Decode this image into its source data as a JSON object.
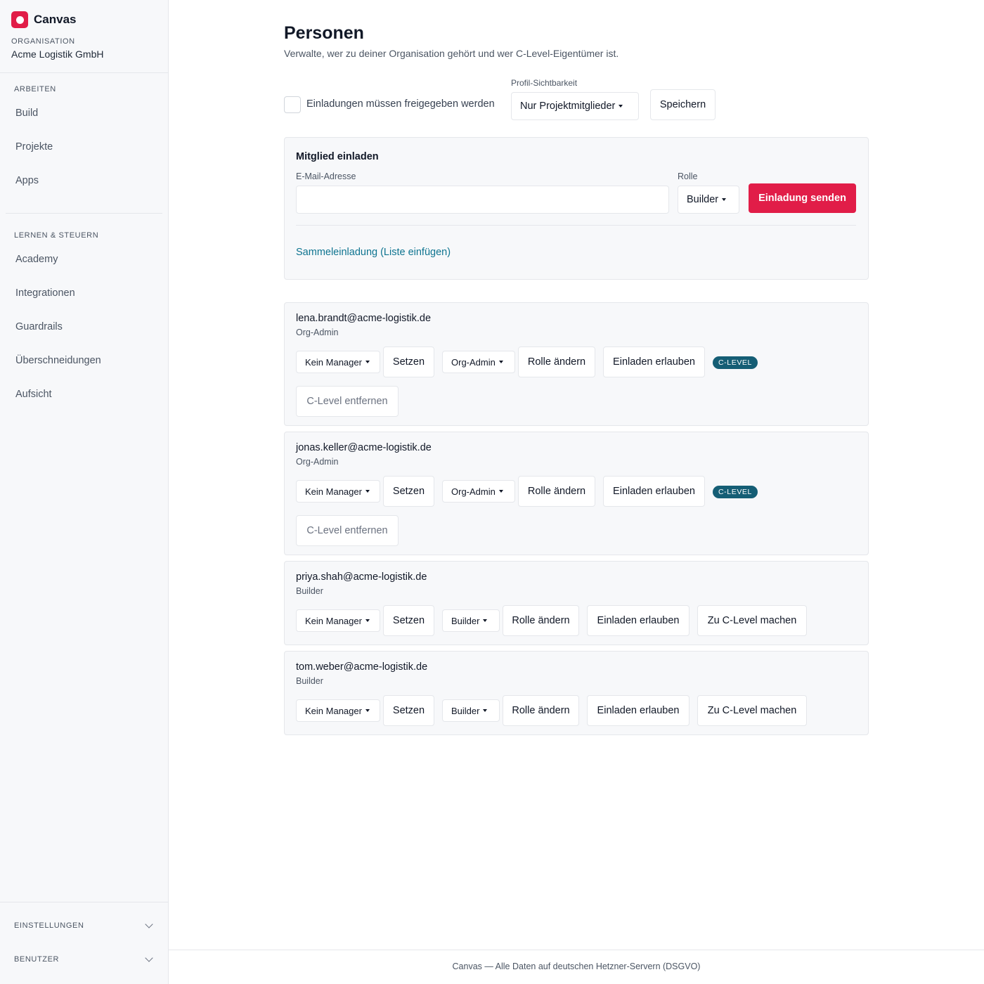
{
  "brand": {
    "name": "Canvas",
    "accent": "#e11d48"
  },
  "organization": {
    "label": "ORGANISATION",
    "name": "Acme Logistik GmbH"
  },
  "sidebar": {
    "sections": [
      {
        "label": "ARBEITEN",
        "items": [
          "Build",
          "Projekte",
          "Apps"
        ]
      },
      {
        "label": "LERNEN & STEUERN",
        "items": [
          "Academy",
          "Integrationen",
          "Guardrails",
          "Überschneidungen",
          "Aufsicht"
        ]
      }
    ],
    "collapsibles": [
      "EINSTELLUNGEN",
      "BENUTZER"
    ]
  },
  "page": {
    "title": "Personen",
    "subtitle": "Verwalte, wer zu deiner Organisation gehört und wer C-Level-Eigentümer ist."
  },
  "settings": {
    "approval_label": "Einladungen müssen freigegeben werden",
    "approval_checked": false,
    "visibility_label": "Profil-Sichtbarkeit",
    "visibility_value": "Nur Projektmitglieder",
    "save_label": "Speichern"
  },
  "invite": {
    "title": "Mitglied einladen",
    "email_label": "E-Mail-Adresse",
    "email_value": "",
    "role_label": "Rolle",
    "role_value": "Builder",
    "send_label": "Einladung senden",
    "bulk_link": "Sammeleinladung (Liste einfügen)"
  },
  "members": [
    {
      "email": "lena.brandt@acme-logistik.de",
      "role": "Org-Admin",
      "manager_value": "Kein Manager",
      "set_label": "Setzen",
      "role_select_value": "Org-Admin",
      "change_role_label": "Rolle ändern",
      "allow_invite_label": "Einladen erlauben",
      "badge": "C-LEVEL",
      "clevel_action": "C-Level entfernen"
    },
    {
      "email": "jonas.keller@acme-logistik.de",
      "role": "Org-Admin",
      "manager_value": "Kein Manager",
      "set_label": "Setzen",
      "role_select_value": "Org-Admin",
      "change_role_label": "Rolle ändern",
      "allow_invite_label": "Einladen erlauben",
      "badge": "C-LEVEL",
      "clevel_action": "C-Level entfernen"
    },
    {
      "email": "priya.shah@acme-logistik.de",
      "role": "Builder",
      "manager_value": "Kein Manager",
      "set_label": "Setzen",
      "role_select_value": "Builder",
      "change_role_label": "Rolle ändern",
      "allow_invite_label": "Einladen erlauben",
      "clevel_action": "Zu C-Level machen"
    },
    {
      "email": "tom.weber@acme-logistik.de",
      "role": "Builder",
      "manager_value": "Kein Manager",
      "set_label": "Setzen",
      "role_select_value": "Builder",
      "change_role_label": "Rolle ändern",
      "allow_invite_label": "Einladen erlauben",
      "clevel_action": "Zu C-Level machen"
    }
  ],
  "footer": {
    "text": "Canvas — Alle Daten auf deutschen Hetzner-Servern (DSGVO)"
  },
  "colors": {
    "primary": "#e11d48",
    "link": "#0e7490",
    "badge": "#155e75",
    "panel": "#f7f8fa",
    "border": "#e5e7eb"
  }
}
